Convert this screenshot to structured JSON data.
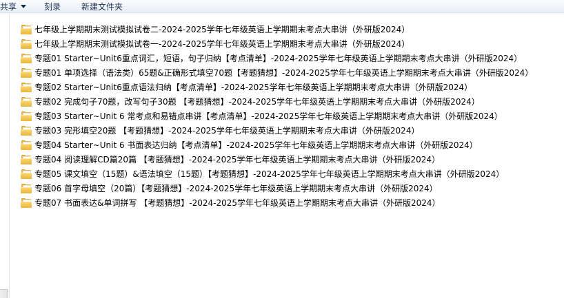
{
  "toolbar": {
    "share_label": "共享",
    "burn_label": "刻录",
    "new_folder_label": "新建文件夹"
  },
  "files": [
    {
      "name": "七年级上学期期末测试模拟试卷二-2024-2025学年七年级英语上学期期末考点大串讲（外研版2024）",
      "icon": "folder-icon"
    },
    {
      "name": "七年级上学期期末测试模拟试卷一-2024-2025学年七年级英语上学期期末考点大串讲（外研版2024）",
      "icon": "folder-icon"
    },
    {
      "name": "专题01 Starter~Unit6重点词汇，短语，句子归纳【考点清单】-2024-2025学年七年级英语上学期期末考点大串讲（外研版2024）",
      "icon": "folder-icon"
    },
    {
      "name": "专题01 单项选择（语法类）65题&正确形式填空70题【考题猜想】-2024-2025学年七年级英语上学期期末考点大串讲（外研版2024）",
      "icon": "folder-icon"
    },
    {
      "name": "专题02 Starter~Unit6重点语法归纳【考点清单】-2024-2025学年七年级英语上学期期末考点大串讲（外研版2024）",
      "icon": "folder-icon"
    },
    {
      "name": "专题02 完成句子70题，改写句子30题 【考题猜想】-2024-2025学年七年级英语上学期期末考点大串讲（外研版2024）",
      "icon": "folder-icon"
    },
    {
      "name": "专题03 Starter~Unit 6 常考点和易错点串讲【考点清单】-2024-2025学年七年级英语上学期期末考点大串讲（外研版2024）",
      "icon": "folder-icon"
    },
    {
      "name": "专题03 完形填空20题 【考题猜想】-2024-2025学年七年级英语上学期期末考点大串讲（外研版2024）",
      "icon": "folder-icon"
    },
    {
      "name": "专题04 Starter~Unit 6 书面表达归纳【考点清单】-2024-2025学年七年级英语上学期期末考点大串讲（外研版2024）",
      "icon": "folder-icon"
    },
    {
      "name": "专题04 阅读理解CD篇20篇 【考题猜想】-2024-2025学年七年级英语上学期期末考点大串讲（外研版2024）",
      "icon": "folder-icon"
    },
    {
      "name": "专题05 课文填空（15题）&语法填空（15题）【考题猜想】-2024-2025学年七年级英语上学期期末考点大串讲（外研版2024）",
      "icon": "folder-icon"
    },
    {
      "name": "专题06 首字母填空（20篇）【考题猜想】-2024-2025学年七年级英语上学期期末考点大串讲（外研版2024）",
      "icon": "folder-icon"
    },
    {
      "name": "专题07 书面表达&单词拼写 【考题猜想】-2024-2025学年七年级英语上学期期末考点大串讲（外研版2024）",
      "icon": "folder-icon"
    }
  ]
}
